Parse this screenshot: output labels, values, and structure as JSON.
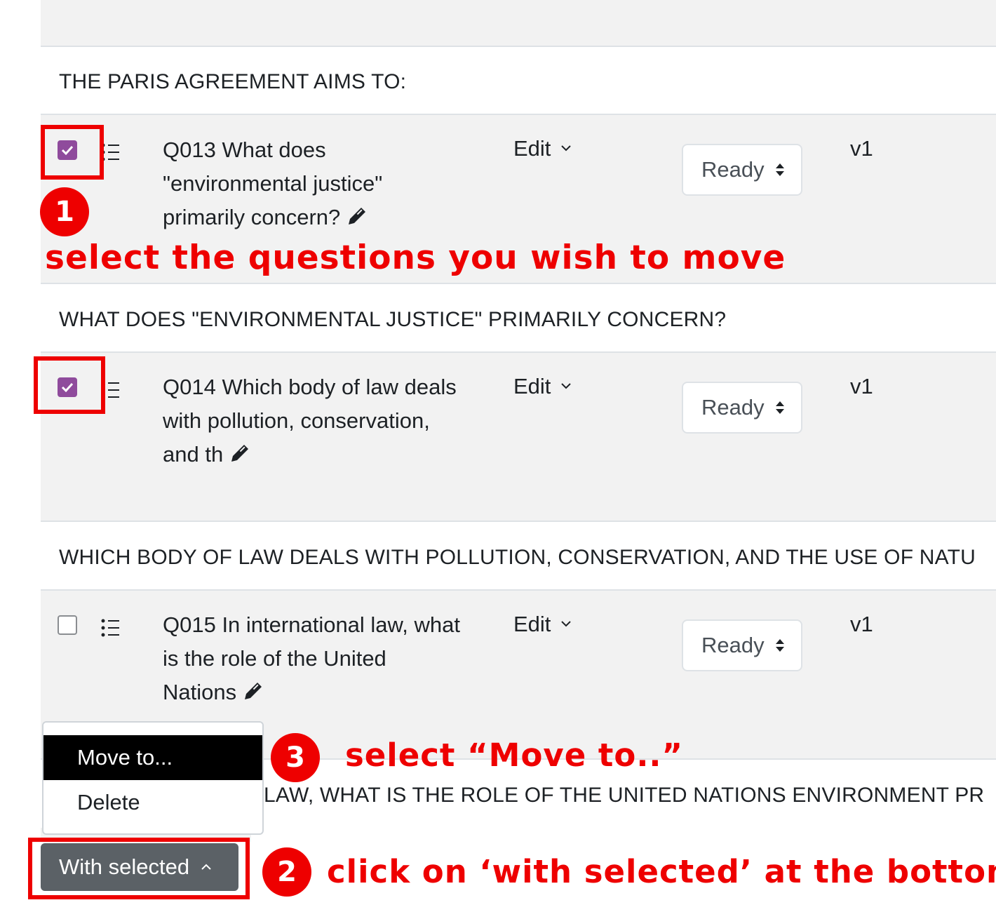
{
  "rows": [
    {
      "question_text_header": "THE PARIS AGREEMENT AIMS TO:",
      "checked": true,
      "name_lines": [
        "Q013 What does",
        "\"environmental justice\"",
        "primarily concern?"
      ],
      "edit_label": "Edit",
      "status": "Ready",
      "version": "v1"
    },
    {
      "question_text_header": "WHAT DOES \"ENVIRONMENTAL JUSTICE\" PRIMARILY CONCERN?",
      "checked": true,
      "name_lines": [
        "Q014 Which body of law deals",
        "with pollution, conservation,",
        "and th"
      ],
      "edit_label": "Edit",
      "status": "Ready",
      "version": "v1"
    },
    {
      "question_text_header": "WHICH BODY OF LAW DEALS WITH POLLUTION, CONSERVATION, AND THE USE OF NATU",
      "checked": false,
      "name_lines": [
        "Q015 In international law, what",
        "is the role of the United",
        "Nations"
      ],
      "edit_label": "Edit",
      "status": "Ready",
      "version": "v1"
    }
  ],
  "partial_header_text": "LAW, WHAT IS THE ROLE OF THE UNITED NATIONS ENVIRONMENT PR",
  "bulk_menu": {
    "items": [
      "Move to...",
      "Delete"
    ],
    "active_item": "Move to...",
    "button_label": "With selected"
  },
  "annotations": {
    "step1_number": "1",
    "step1_text": "select the questions you wish to move",
    "step2_number": "2",
    "step2_text": "click on ‘with selected’ at the bottom",
    "step3_number": "3",
    "step3_text": "select “Move to..”"
  },
  "colors": {
    "annotation_red": "#ee0000",
    "checkbox_purple": "#8f4b9c",
    "button_gray": "#5b6166",
    "row_gray": "#f2f2f2"
  },
  "icons": {
    "drag": "list-drag-icon",
    "edit": "pencil-icon",
    "dropdown": "chevron-down-icon",
    "select": "up-down-caret-icon",
    "button": "chevron-up-icon",
    "check": "checkmark-icon"
  }
}
